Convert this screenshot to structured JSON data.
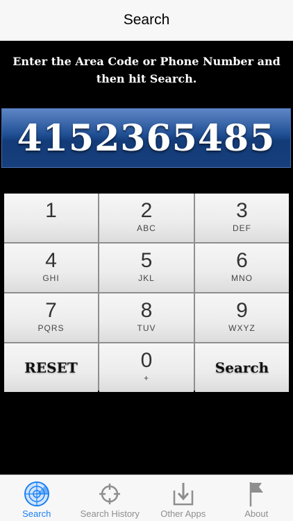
{
  "navbar": {
    "title": "Search"
  },
  "instructions": "Enter the Area Code or Phone Number and then hit Search.",
  "display": {
    "number": "4152365485"
  },
  "keypad": {
    "keys": [
      {
        "digit": "1",
        "letters": ""
      },
      {
        "digit": "2",
        "letters": "ABC"
      },
      {
        "digit": "3",
        "letters": "DEF"
      },
      {
        "digit": "4",
        "letters": "GHI"
      },
      {
        "digit": "5",
        "letters": "JKL"
      },
      {
        "digit": "6",
        "letters": "MNO"
      },
      {
        "digit": "7",
        "letters": "PQRS"
      },
      {
        "digit": "8",
        "letters": "TUV"
      },
      {
        "digit": "9",
        "letters": "WXYZ"
      },
      {
        "digit": "0",
        "letters": "+"
      }
    ],
    "reset_label": "RESET",
    "search_label": "Search"
  },
  "tabbar": {
    "tabs": [
      {
        "label": "Search",
        "icon": "radar-icon",
        "active": true
      },
      {
        "label": "Search History",
        "icon": "crosshair-icon",
        "active": false
      },
      {
        "label": "Other Apps",
        "icon": "download-icon",
        "active": false
      },
      {
        "label": "About",
        "icon": "flag-icon",
        "active": false
      }
    ]
  },
  "colors": {
    "accent": "#1a7ff5",
    "inactive": "#8e8e8e",
    "display_blue": "#1f4e93"
  }
}
